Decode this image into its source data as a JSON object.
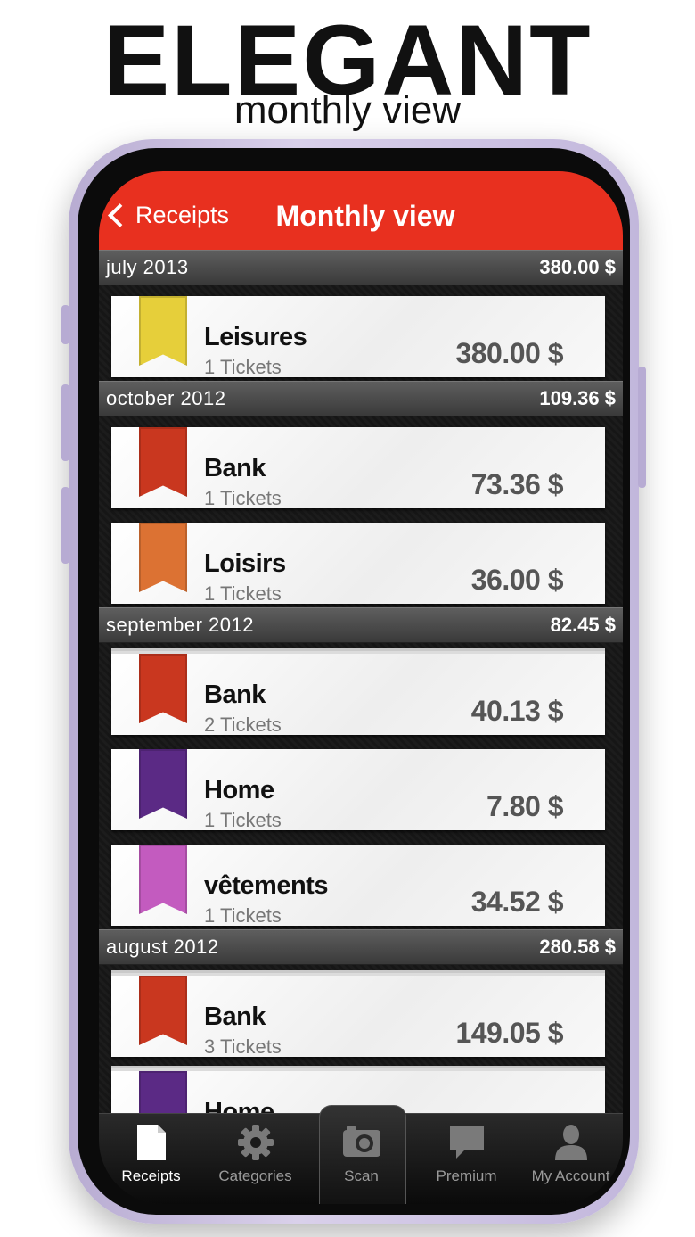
{
  "promo": {
    "headline": "ELEGANT",
    "subline": "monthly view"
  },
  "navbar": {
    "back_label": "Receipts",
    "title": "Monthly view"
  },
  "sections": [
    {
      "month": "july 2013",
      "total": "380.00 $",
      "items": [
        {
          "name": "Leisures",
          "tickets": "1 Tickets",
          "amount": "380.00 $",
          "color": "#e6cf3a"
        }
      ]
    },
    {
      "month": "october 2012",
      "total": "109.36 $",
      "items": [
        {
          "name": "Bank",
          "tickets": "1 Tickets",
          "amount": "73.36 $",
          "color": "#c9371f"
        },
        {
          "name": "Loisirs",
          "tickets": "1 Tickets",
          "amount": "36.00 $",
          "color": "#dc7233"
        }
      ]
    },
    {
      "month": "september 2012",
      "total": "82.45 $",
      "items": [
        {
          "name": "Bank",
          "tickets": "2 Tickets",
          "amount": "40.13 $",
          "color": "#c9371f"
        },
        {
          "name": "Home",
          "tickets": "1 Tickets",
          "amount": "7.80 $",
          "color": "#5b2a85"
        },
        {
          "name": "vêtements",
          "tickets": "1 Tickets",
          "amount": "34.52 $",
          "color": "#c35bbf"
        }
      ]
    },
    {
      "month": "august 2012",
      "total": "280.58 $",
      "items": [
        {
          "name": "Bank",
          "tickets": "3 Tickets",
          "amount": "149.05 $",
          "color": "#c9371f"
        },
        {
          "name": "Home",
          "tickets": "",
          "amount": "",
          "color": "#5b2a85"
        }
      ]
    }
  ],
  "tabbar": {
    "tabs": [
      {
        "label": "Receipts",
        "icon": "document-icon"
      },
      {
        "label": "Categories",
        "icon": "gear-icon"
      },
      {
        "label": "Scan",
        "icon": "camera-icon"
      },
      {
        "label": "Premium",
        "icon": "speech-bubble-icon"
      },
      {
        "label": "My Account",
        "icon": "person-icon"
      }
    ],
    "active": "Receipts"
  }
}
